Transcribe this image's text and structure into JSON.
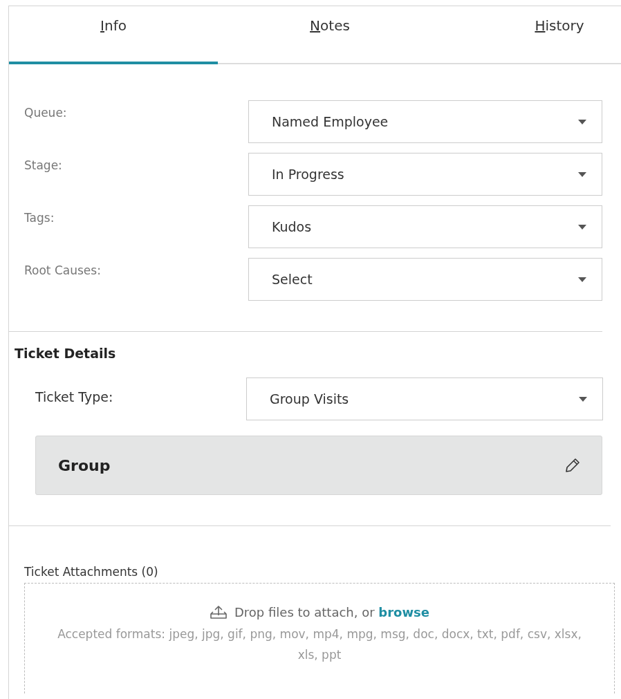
{
  "tabs": [
    {
      "key": "I",
      "rest": "nfo",
      "selected": true
    },
    {
      "key": "N",
      "rest": "otes",
      "selected": false
    },
    {
      "key": "H",
      "rest": "istory",
      "selected": false
    }
  ],
  "fields": [
    {
      "label": "Queue:",
      "value": "Named Employee"
    },
    {
      "label": "Stage:",
      "value": "In Progress"
    },
    {
      "label": "Tags:",
      "value": "Kudos"
    },
    {
      "label": "Root Causes:",
      "value": "Select"
    }
  ],
  "ticket_details": {
    "heading": "Ticket Details",
    "type_label": "Ticket Type:",
    "type_value": "Group Visits",
    "card_title": "Group"
  },
  "attachments": {
    "heading": "Ticket Attachments (0)",
    "drop_text": "Drop files to attach, or",
    "browse_link": "browse",
    "formats": "Accepted formats: jpeg, jpg, gif, png, mov, mp4, mpg, msg, doc, docx, txt, pdf, csv, xlsx, xls, ppt"
  }
}
